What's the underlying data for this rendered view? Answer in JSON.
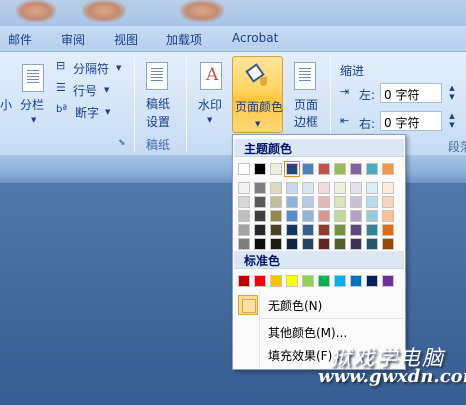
{
  "tabs": [
    "邮件",
    "审阅",
    "视图",
    "加载项",
    "Acrobat"
  ],
  "ribbon": {
    "size_partial": "小",
    "columns": "分栏",
    "breaks": "分隔符",
    "line_numbers": "行号",
    "hyphenation": "断字",
    "draft_paper_1": "稿纸",
    "draft_paper_2": "设置",
    "draft_paper_group": "稿纸",
    "watermark": "水印",
    "page_color": "页面颜色",
    "page_borders_1": "页面",
    "page_borders_2": "边框",
    "indent_title": "缩进",
    "left_label": "左:",
    "left_value": "0 字符",
    "right_label": "右:",
    "right_value": "0 字符",
    "paragraph_group_partial": "段落"
  },
  "dropdown": {
    "theme_colors_title": "主题颜色",
    "standard_colors_title": "标准色",
    "no_color": "无颜色(N)",
    "more_colors": "其他颜色(M)...",
    "fill_effects": "填充效果(F)...",
    "selected_swatch": "#1f497d",
    "theme_top": [
      "#ffffff",
      "#000000",
      "#eeece1",
      "#1f497d",
      "#4f81bd",
      "#c0504d",
      "#9bbb59",
      "#8064a2",
      "#4bacc6",
      "#f79646"
    ],
    "theme_shades": [
      [
        "#f2f2f2",
        "#7f7f7f",
        "#ddd9c3",
        "#c6d9f0",
        "#dbe5f1",
        "#f2dcdb",
        "#ebf1dd",
        "#e5e0ec",
        "#dbeef3",
        "#fdeada"
      ],
      [
        "#d8d8d8",
        "#595959",
        "#c4bd97",
        "#8db3e2",
        "#b8cce4",
        "#e5b9b7",
        "#d7e3bc",
        "#ccc1d9",
        "#b7dde8",
        "#fbd5b5"
      ],
      [
        "#bfbfbf",
        "#3f3f3f",
        "#938953",
        "#548dd4",
        "#95b3d7",
        "#d99694",
        "#c3d69b",
        "#b2a2c7",
        "#92cddc",
        "#fac08f"
      ],
      [
        "#a5a5a5",
        "#262626",
        "#494429",
        "#17365d",
        "#366092",
        "#953734",
        "#76923c",
        "#5f497a",
        "#31859b",
        "#e36c09"
      ],
      [
        "#7f7f7f",
        "#0c0c0c",
        "#1d1b10",
        "#0f243e",
        "#244061",
        "#632423",
        "#4f6128",
        "#3f3151",
        "#205867",
        "#974806"
      ]
    ],
    "standard": [
      "#c00000",
      "#ff0000",
      "#ffc000",
      "#ffff00",
      "#92d050",
      "#00b050",
      "#00b0f0",
      "#0070c0",
      "#002060",
      "#7030a0"
    ]
  },
  "watermark": {
    "line1": "狱戏学电脑",
    "line2": "www.gwxdn.com"
  }
}
